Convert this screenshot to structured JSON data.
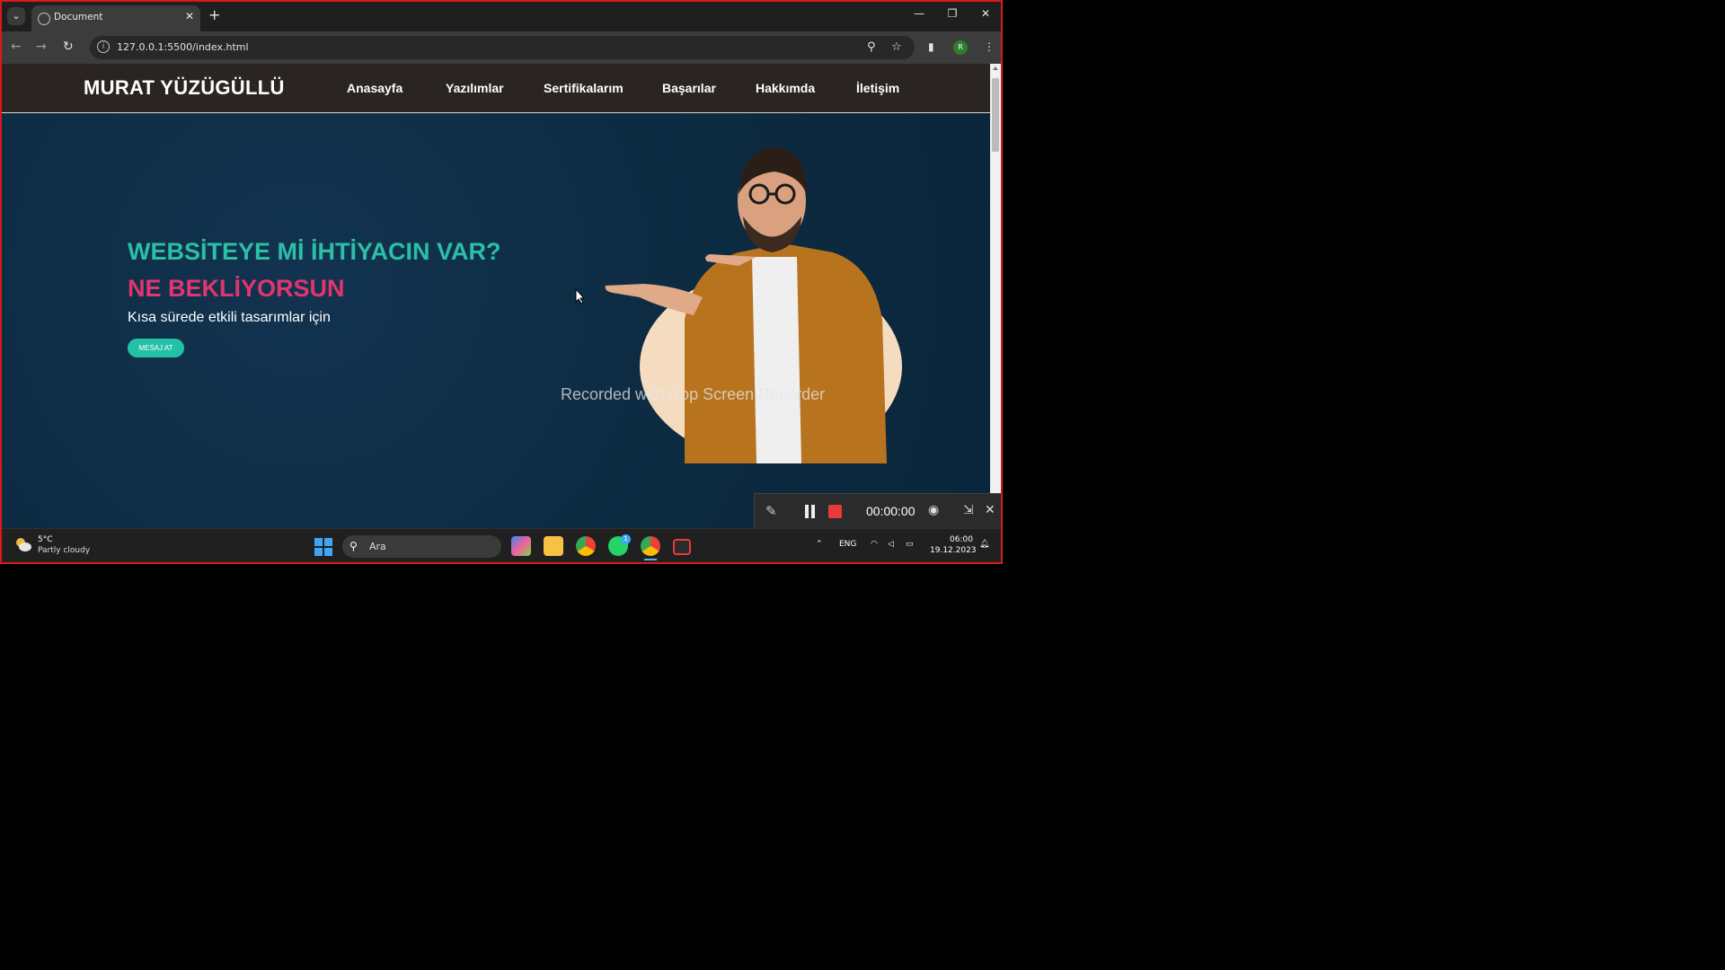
{
  "browser": {
    "tab_title": "Document",
    "new_tab": "+",
    "url": "127.0.0.1:5500/index.html",
    "profile_initial": "R"
  },
  "site": {
    "logo": "MURAT YÜZÜGÜLLÜ",
    "nav": [
      "Anasayfa",
      "Yazılımlar",
      "Sertifikalarım",
      "Başarılar",
      "Hakkımda",
      "İletişim"
    ]
  },
  "hero": {
    "headline1": "WEBSİTEYE Mİ İHTİYACIN VAR?",
    "headline2": "NE BEKLİYORSUN",
    "subline": "Kısa sürede etkili tasarımlar için",
    "cta": "MESAJ AT",
    "watermark": "Recorded with iTop Screen Recorder"
  },
  "recorder": {
    "time": "00:00:00"
  },
  "taskbar": {
    "weather_temp": "5°C",
    "weather_condition": "Partly cloudy",
    "search_placeholder": "Ara",
    "language": "ENG",
    "time": "06:00",
    "date": "19.12.2023",
    "whatsapp_badge": "1"
  },
  "colors": {
    "accent_teal": "#2bbfa6",
    "accent_pink": "#e0356d",
    "hero_bg": "#0e2e45",
    "header_bg": "#2a2522",
    "frame_red": "#d71a1a"
  }
}
